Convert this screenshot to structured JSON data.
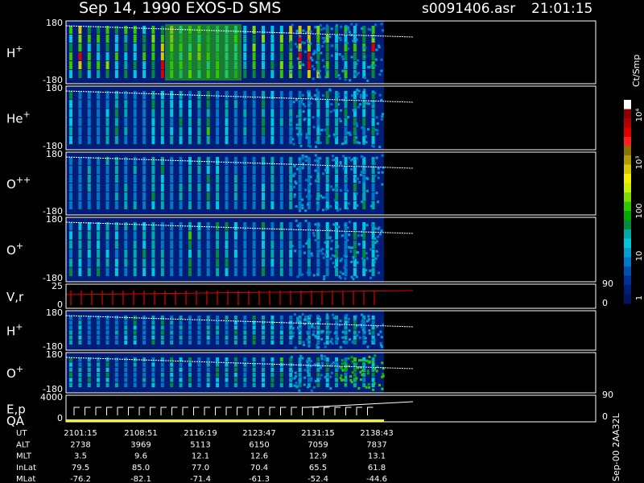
{
  "header": {
    "title": "Sep 14, 1990    EXOS-D SMS",
    "file": "s0091406.asr",
    "time": "21:01:15"
  },
  "colorbar": {
    "unit": "Ct/Smp",
    "ticks": [
      "10⁴",
      "10³",
      "100",
      "10",
      "1"
    ],
    "colors": [
      "#ffffff",
      "#8b0000",
      "#b40000",
      "#e00000",
      "#ff2020",
      "#8b7300",
      "#b49b00",
      "#d7c800",
      "#f5f000",
      "#c8f000",
      "#7fdc00",
      "#32c800",
      "#00aa00",
      "#008c3c",
      "#00aaaa",
      "#00c8dc",
      "#00a0d0",
      "#0078c8",
      "#0050b4",
      "#003096",
      "#001e78",
      "#001464"
    ]
  },
  "panels": [
    {
      "label": "H",
      "sup": "+",
      "ymax": "180",
      "ymin": "-180"
    },
    {
      "label": "He",
      "sup": "+",
      "ymax": "180",
      "ymin": "-180"
    },
    {
      "label": "O",
      "sup": "++",
      "ymax": "180",
      "ymin": "-180"
    },
    {
      "label": "O",
      "sup": "+",
      "ymax": "180",
      "ymin": "-180"
    },
    {
      "label": "V,r",
      "sup": "",
      "ymax": "25",
      "ymin": "0",
      "rmax": "90",
      "rmin": "0"
    },
    {
      "label": "H",
      "sup": "+",
      "ymax": "180",
      "ymin": "-180"
    },
    {
      "label": "O",
      "sup": "+",
      "ymax": "180",
      "ymin": "-180"
    },
    {
      "label": "E,p",
      "sup": "",
      "label2": "QA",
      "ymax": "4000",
      "ymin": "0",
      "rmax": "90",
      "rmin": "0"
    }
  ],
  "chart_data": {
    "type": "heatmap",
    "x_label": "UT",
    "x": [
      "2101:15",
      "2108:51",
      "2116:19",
      "2123:47",
      "2131:15",
      "2138:43"
    ],
    "ephemeris": [
      {
        "name": "UT",
        "values": [
          "2101:15",
          "2108:51",
          "2116:19",
          "2123:47",
          "2131:15",
          "2138:43"
        ]
      },
      {
        "name": "ALT",
        "values": [
          "2738",
          "3969",
          "5113",
          "6150",
          "7059",
          "7837"
        ]
      },
      {
        "name": "MLT",
        "values": [
          "3.5",
          "9.6",
          "12.1",
          "12.6",
          "12.9",
          "13.1"
        ]
      },
      {
        "name": "InLat",
        "values": [
          "79.5",
          "85.0",
          "77.0",
          "70.4",
          "65.5",
          "61.8"
        ]
      },
      {
        "name": "MLat",
        "values": [
          "-76.2",
          "-82.1",
          "-71.4",
          "-61.3",
          "-52.4",
          "-44.6"
        ]
      }
    ],
    "footer_vertical": "Sep-00  2AA32L"
  }
}
